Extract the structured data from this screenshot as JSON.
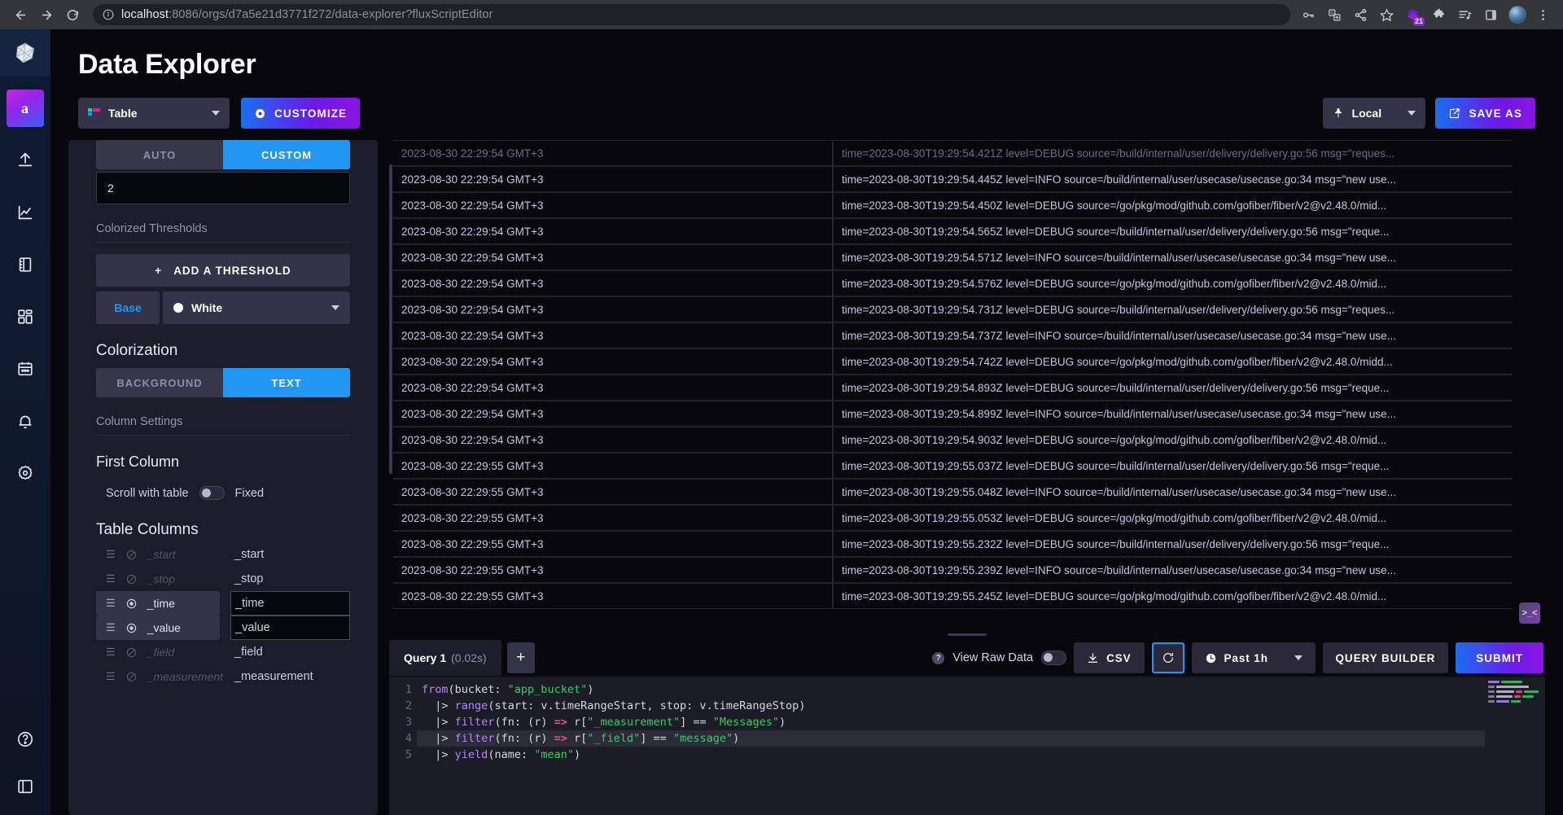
{
  "browser": {
    "url_host": "localhost",
    "url_rest": ":8086/orgs/d7a5e21d3771f272/data-explorer?fluxScriptEditor",
    "extension_badge": "21",
    "icons": [
      "back-arrow",
      "forward-arrow",
      "reload",
      "info-circle",
      "key",
      "translate",
      "share",
      "bookmark-star",
      "extension-purple",
      "puzzle-extension",
      "media-list",
      "side-panel",
      "profile-avatar",
      "overflow-menu"
    ]
  },
  "nav": {
    "org_initial": "a",
    "items": [
      "logo",
      "org",
      "upload",
      "graph",
      "notebook",
      "dashboards",
      "calendar",
      "alerts",
      "settings",
      "help",
      "collapse"
    ]
  },
  "header": {
    "title": "Data Explorer",
    "viz_type": "Table",
    "customize_label": "CUSTOMIZE",
    "local_label": "Local",
    "save_as_label": "SAVE AS"
  },
  "options": {
    "decimal_seg": {
      "auto": "AUTO",
      "custom": "CUSTOM",
      "selected": "CUSTOM"
    },
    "decimal_value": "2",
    "thresholds_label": "Colorized Thresholds",
    "add_threshold_label": "ADD A THRESHOLD",
    "base_label": "Base",
    "base_color": "White",
    "colorization_label": "Colorization",
    "colorization_seg": {
      "background": "BACKGROUND",
      "text": "TEXT",
      "selected": "TEXT"
    },
    "column_settings_label": "Column Settings",
    "first_column_label": "First Column",
    "scroll_label": "Scroll with table",
    "fixed_label": "Fixed",
    "table_columns_label": "Table Columns",
    "columns": [
      {
        "name": "_start",
        "display": "_start",
        "visible": false
      },
      {
        "name": "_stop",
        "display": "_stop",
        "visible": false
      },
      {
        "name": "_time",
        "display": "_time",
        "visible": true
      },
      {
        "name": "_value",
        "display": "_value",
        "visible": true
      },
      {
        "name": "_field",
        "display": "_field",
        "visible": false
      },
      {
        "name": "_measurement",
        "display": "_measurement",
        "visible": false
      }
    ]
  },
  "table": {
    "rows": [
      {
        "time": "2023-08-30 22:29:54 GMT+3",
        "value": "time=2023-08-30T19:29:54.421Z level=DEBUG source=/build/internal/user/delivery/delivery.go:56 msg=\"reques...",
        "clipped": true
      },
      {
        "time": "2023-08-30 22:29:54 GMT+3",
        "value": "time=2023-08-30T19:29:54.445Z level=INFO source=/build/internal/user/usecase/usecase.go:34 msg=\"new use..."
      },
      {
        "time": "2023-08-30 22:29:54 GMT+3",
        "value": "time=2023-08-30T19:29:54.450Z level=DEBUG source=/go/pkg/mod/github.com/gofiber/fiber/v2@v2.48.0/mid..."
      },
      {
        "time": "2023-08-30 22:29:54 GMT+3",
        "value": "time=2023-08-30T19:29:54.565Z level=DEBUG source=/build/internal/user/delivery/delivery.go:56 msg=\"reque..."
      },
      {
        "time": "2023-08-30 22:29:54 GMT+3",
        "value": "time=2023-08-30T19:29:54.571Z level=INFO source=/build/internal/user/usecase/usecase.go:34 msg=\"new use..."
      },
      {
        "time": "2023-08-30 22:29:54 GMT+3",
        "value": "time=2023-08-30T19:29:54.576Z level=DEBUG source=/go/pkg/mod/github.com/gofiber/fiber/v2@v2.48.0/mid..."
      },
      {
        "time": "2023-08-30 22:29:54 GMT+3",
        "value": "time=2023-08-30T19:29:54.731Z level=DEBUG source=/build/internal/user/delivery/delivery.go:56 msg=\"reques..."
      },
      {
        "time": "2023-08-30 22:29:54 GMT+3",
        "value": "time=2023-08-30T19:29:54.737Z level=INFO source=/build/internal/user/usecase/usecase.go:34 msg=\"new use..."
      },
      {
        "time": "2023-08-30 22:29:54 GMT+3",
        "value": "time=2023-08-30T19:29:54.742Z level=DEBUG source=/go/pkg/mod/github.com/gofiber/fiber/v2@v2.48.0/midd..."
      },
      {
        "time": "2023-08-30 22:29:54 GMT+3",
        "value": "time=2023-08-30T19:29:54.893Z level=DEBUG source=/build/internal/user/delivery/delivery.go:56 msg=\"reque..."
      },
      {
        "time": "2023-08-30 22:29:54 GMT+3",
        "value": "time=2023-08-30T19:29:54.899Z level=INFO source=/build/internal/user/usecase/usecase.go:34 msg=\"new use..."
      },
      {
        "time": "2023-08-30 22:29:54 GMT+3",
        "value": "time=2023-08-30T19:29:54.903Z level=DEBUG source=/go/pkg/mod/github.com/gofiber/fiber/v2@v2.48.0/mid..."
      },
      {
        "time": "2023-08-30 22:29:55 GMT+3",
        "value": "time=2023-08-30T19:29:55.037Z level=DEBUG source=/build/internal/user/delivery/delivery.go:56 msg=\"reque..."
      },
      {
        "time": "2023-08-30 22:29:55 GMT+3",
        "value": "time=2023-08-30T19:29:55.048Z level=INFO source=/build/internal/user/usecase/usecase.go:34 msg=\"new use..."
      },
      {
        "time": "2023-08-30 22:29:55 GMT+3",
        "value": "time=2023-08-30T19:29:55.053Z level=DEBUG source=/go/pkg/mod/github.com/gofiber/fiber/v2@v2.48.0/mid..."
      },
      {
        "time": "2023-08-30 22:29:55 GMT+3",
        "value": "time=2023-08-30T19:29:55.232Z level=DEBUG source=/build/internal/user/delivery/delivery.go:56 msg=\"reque..."
      },
      {
        "time": "2023-08-30 22:29:55 GMT+3",
        "value": "time=2023-08-30T19:29:55.239Z level=INFO source=/build/internal/user/usecase/usecase.go:34 msg=\"new use..."
      },
      {
        "time": "2023-08-30 22:29:55 GMT+3",
        "value": "time=2023-08-30T19:29:55.245Z level=DEBUG source=/go/pkg/mod/github.com/gofiber/fiber/v2@v2.48.0/mid..."
      }
    ]
  },
  "query_toolbar": {
    "tab_label": "Query 1",
    "tab_time": "(0.02s)",
    "add_tab": "+",
    "raw_data_label": "View Raw Data",
    "csv_label": "CSV",
    "time_range": "Past 1h",
    "query_builder_label": "QUERY BUILDER",
    "submit_label": "SUBMIT"
  },
  "editor": {
    "line_numbers": [
      "1",
      "2",
      "3",
      "4",
      "5"
    ],
    "active_line": 4,
    "lines": [
      "from(bucket: \"app_bucket\")",
      "  |> range(start: v.timeRangeStart, stop: v.timeRangeStop)",
      "  |> filter(fn: (r) => r[\"_measurement\"] == \"Messages\")",
      "  |> filter(fn: (r) => r[\"_field\"] == \"message\")",
      "  |> yield(name: \"mean\")"
    ]
  },
  "colors": {
    "accent_blue": "#2196f3",
    "brand_gradient_start": "#1a6ef2",
    "brand_gradient_end": "#8a14e0",
    "panel_bg": "#1c1c2b",
    "page_bg": "#07070c"
  }
}
